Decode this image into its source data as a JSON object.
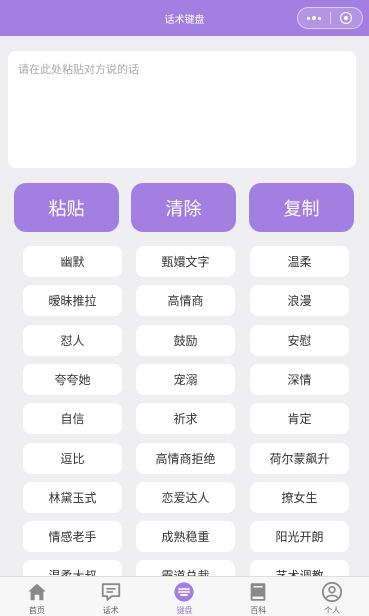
{
  "navbar": {
    "title": "话术键盘"
  },
  "input": {
    "placeholder": "请在此处粘贴对方说的话"
  },
  "actions": [
    {
      "label": "粘贴"
    },
    {
      "label": "清除"
    },
    {
      "label": "复制"
    }
  ],
  "categories": [
    "幽默",
    "甄嬛文字",
    "温柔",
    "暧昧推拉",
    "高情商",
    "浪漫",
    "怼人",
    "鼓励",
    "安慰",
    "夸夸她",
    "宠溺",
    "深情",
    "自信",
    "祈求",
    "肯定",
    "逗比",
    "高情商拒绝",
    "荷尔蒙飙升",
    "林黛玉式",
    "恋爱达人",
    "撩女生",
    "情感老手",
    "成熟稳重",
    "阳光开朗",
    "温柔大叔",
    "霸道总裁",
    "艺术调教"
  ],
  "tabbar": {
    "items": [
      {
        "label": "首页",
        "icon": "home-icon"
      },
      {
        "label": "话术",
        "icon": "chat-icon"
      },
      {
        "label": "键盘",
        "icon": "keyboard-icon"
      },
      {
        "label": "百科",
        "icon": "book-icon"
      },
      {
        "label": "个人",
        "icon": "user-icon"
      }
    ],
    "active_index": 2
  },
  "colors": {
    "accent": "#a27fe0",
    "background": "#efeff2",
    "inactive_icon": "#8a8a8a"
  }
}
